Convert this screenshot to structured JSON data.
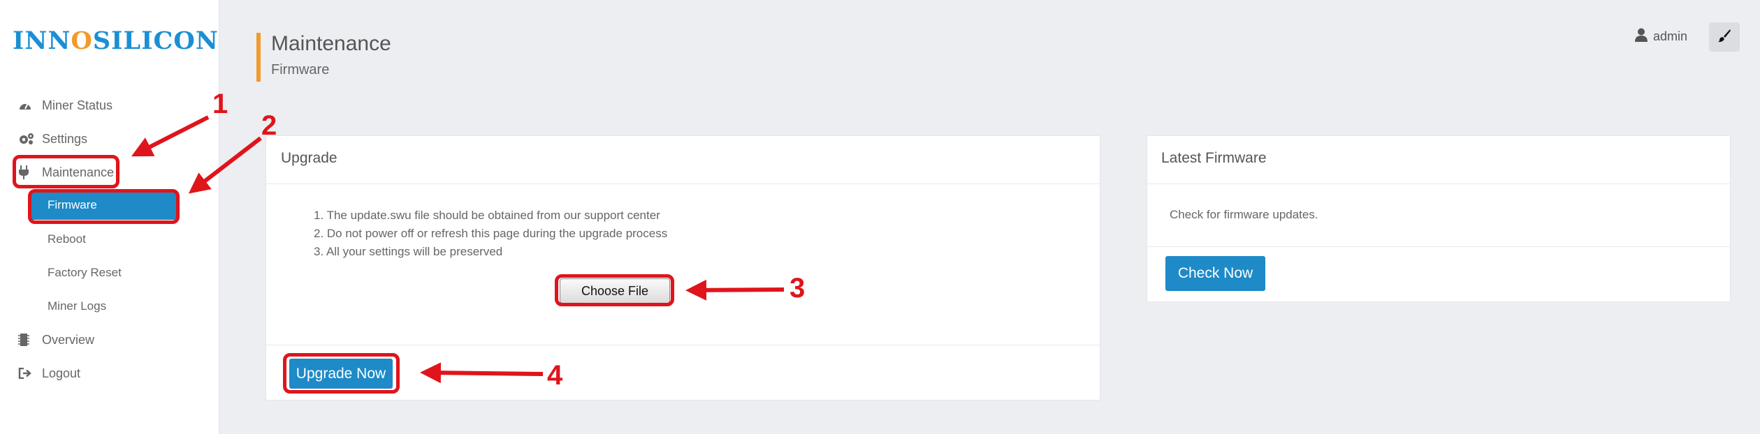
{
  "brand": {
    "before": "INN",
    "o": "O",
    "mid": "SILIC",
    "o2": "O",
    "after": "N"
  },
  "sidebar": {
    "items": [
      {
        "label": "Miner Status",
        "icon": "dashboard-icon"
      },
      {
        "label": "Settings",
        "icon": "gears-icon"
      },
      {
        "label": "Maintenance",
        "icon": "plug-icon"
      },
      {
        "label": "Overview",
        "icon": "chip-icon"
      },
      {
        "label": "Logout",
        "icon": "sign-out-icon"
      }
    ],
    "sub_items": [
      {
        "label": "Firmware",
        "active": true
      },
      {
        "label": "Reboot"
      },
      {
        "label": "Factory Reset"
      },
      {
        "label": "Miner Logs"
      }
    ]
  },
  "header": {
    "title": "Maintenance",
    "subtitle": "Firmware",
    "user": "admin"
  },
  "upgrade_panel": {
    "title": "Upgrade",
    "steps": [
      "1. The update.swu file should be obtained from our support center",
      "2. Do not power off or refresh this page during the upgrade process",
      "3. All your settings will be preserved"
    ],
    "choose_file_label": "Choose File",
    "upgrade_button": "Upgrade Now"
  },
  "latest_panel": {
    "title": "Latest Firmware",
    "text": "Check for firmware updates.",
    "button": "Check Now"
  },
  "annotations": [
    "1",
    "2",
    "3",
    "4"
  ],
  "colors": {
    "accent": "#1e8ac8",
    "highlight": "#e0141b",
    "header_bar": "#f39a2a",
    "logo_blue": "#1b8fd3",
    "logo_orange": "#f39a2a"
  }
}
